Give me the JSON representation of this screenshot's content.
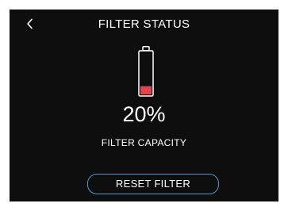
{
  "header": {
    "title": "FILTER STATUS",
    "back_icon": "chevron-left-icon"
  },
  "filter": {
    "capacity_percent": 20,
    "capacity_label": "20%",
    "capacity_caption": "FILTER CAPACITY",
    "icon": "battery-icon"
  },
  "actions": {
    "reset_label": "RESET FILTER"
  },
  "colors": {
    "background": "#0e0e0e",
    "text": "#ffffff",
    "fill_low": "#e8414d",
    "button_border": "#4f97d6"
  }
}
